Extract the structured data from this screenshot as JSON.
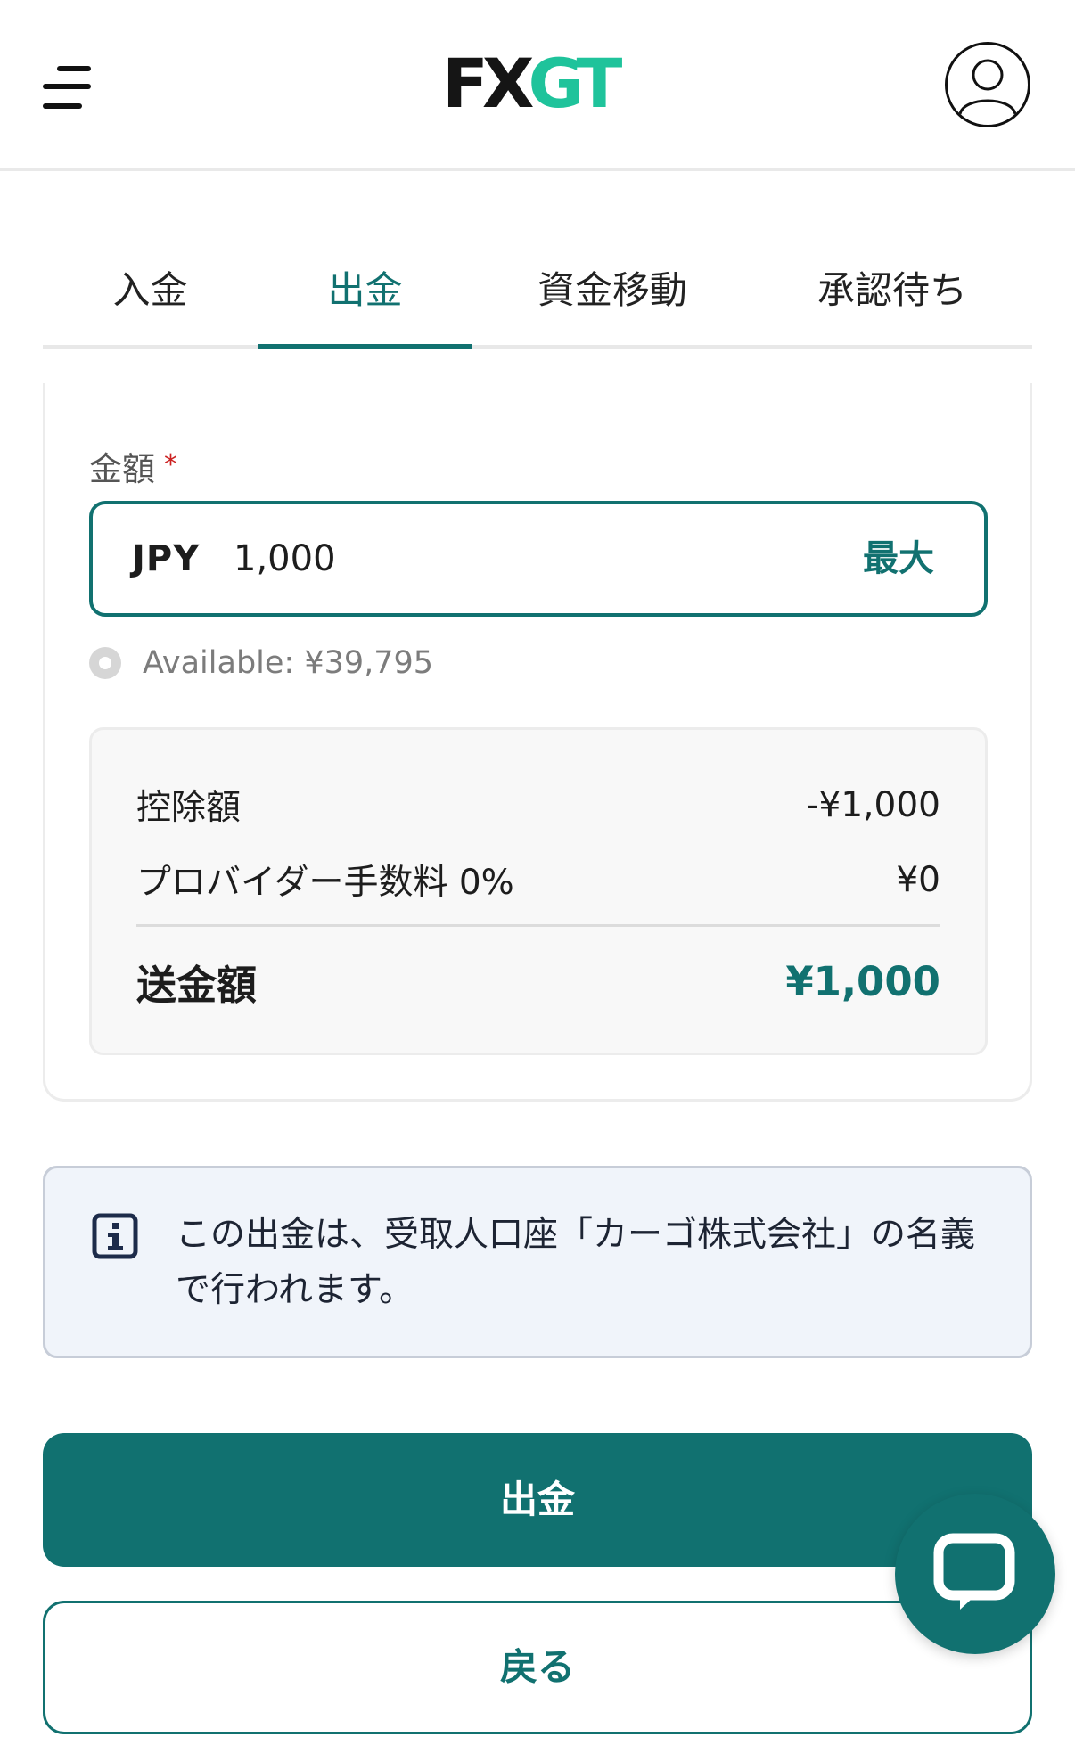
{
  "header": {
    "logo_fx": "FX",
    "logo_gt": "GT",
    "menu_icon": "hamburger-menu-icon",
    "user_icon": "user-avatar-icon"
  },
  "tabs": [
    {
      "label": "入金",
      "active": false
    },
    {
      "label": "出金",
      "active": true
    },
    {
      "label": "資金移動",
      "active": false
    },
    {
      "label": "承認待ち",
      "active": false
    }
  ],
  "form": {
    "amount_label": "金額",
    "required_mark": "*",
    "currency": "JPY",
    "amount_value": "1,000",
    "max_label": "最大",
    "available": "Available: ¥39,795"
  },
  "summary": {
    "deduction_label": "控除額",
    "deduction_value": "-¥1,000",
    "fee_label": "プロバイダー手数料 0%",
    "fee_value": "¥0",
    "total_label": "送金額",
    "total_value": "¥1,000"
  },
  "notice": {
    "icon": "info-icon",
    "text": "この出金は、受取人口座「カーゴ株式会社」の名義で行われます。"
  },
  "actions": {
    "withdraw_label": "出金",
    "back_label": "戻る",
    "chat_icon": "chat-bubble-icon"
  },
  "colors": {
    "primary": "#117170",
    "brand_green": "#1fc39b",
    "info_bg": "#f0f4fa",
    "required": "#cc2222"
  }
}
